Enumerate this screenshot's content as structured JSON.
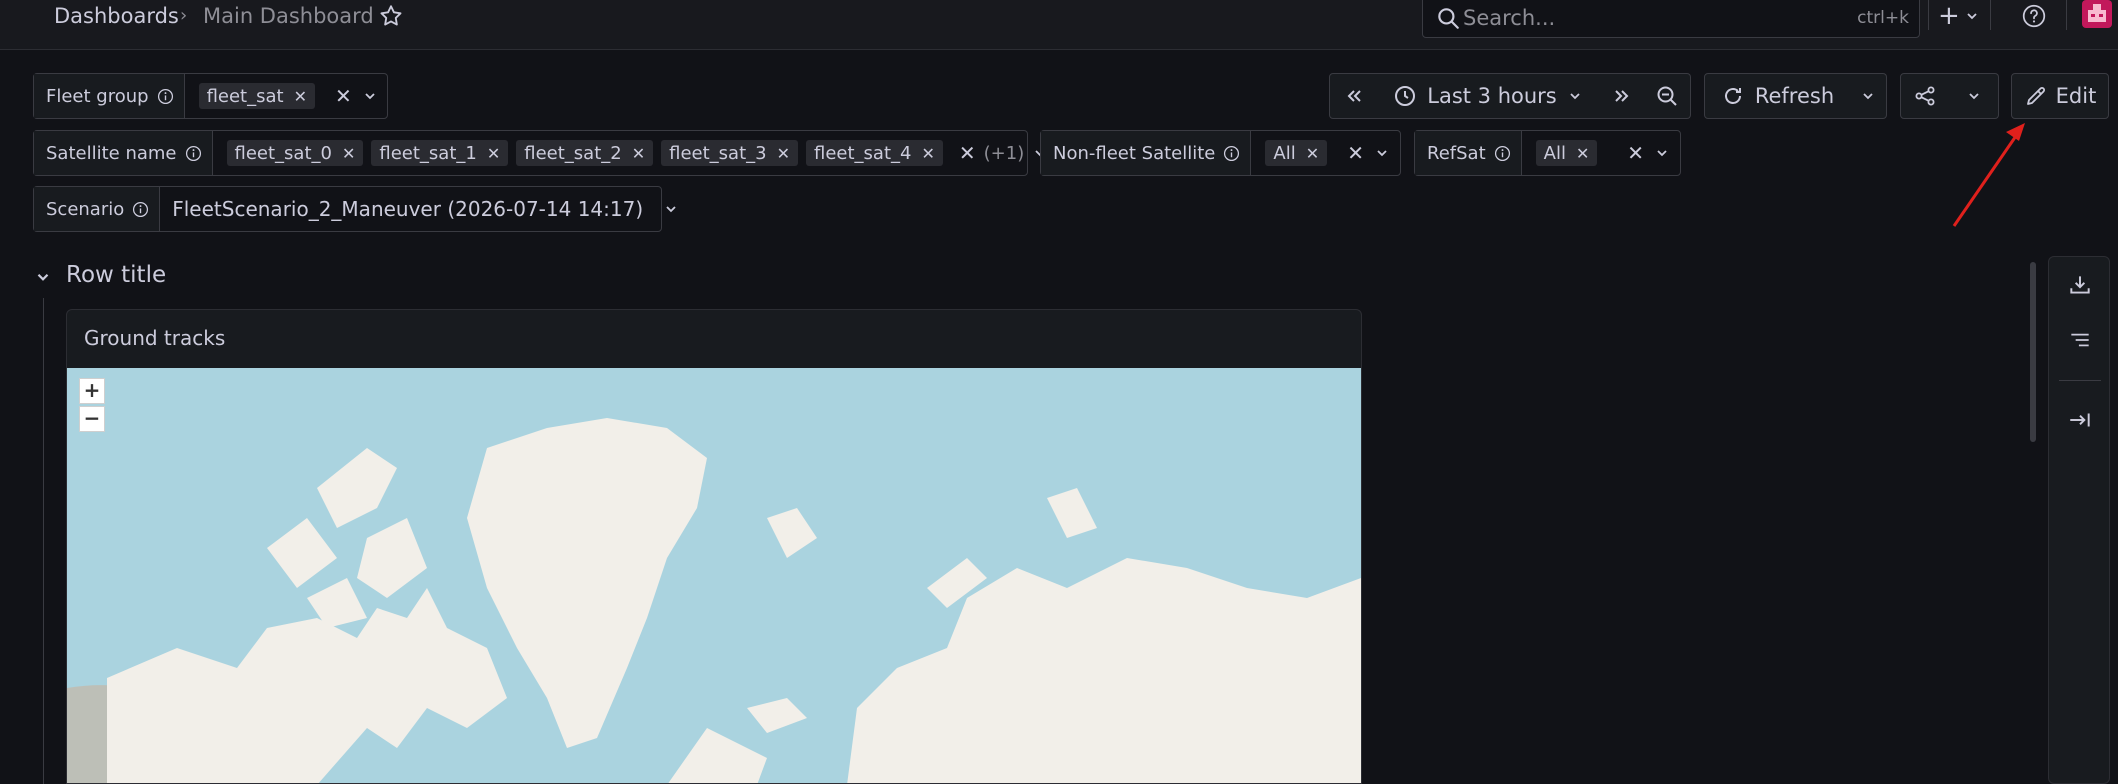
{
  "header": {
    "breadcrumb_root": "Dashboards",
    "breadcrumb_separator": "›",
    "breadcrumb_current": "Main Dashboard",
    "search_placeholder": "Search...",
    "search_shortcut": "ctrl+k",
    "add_label": "+"
  },
  "variables": {
    "fleet_group": {
      "label": "Fleet group",
      "chips": [
        "fleet_sat"
      ]
    },
    "satellite_name": {
      "label": "Satellite name",
      "chips": [
        "fleet_sat_0",
        "fleet_sat_1",
        "fleet_sat_2",
        "fleet_sat_3",
        "fleet_sat_4"
      ],
      "more": "(+1)"
    },
    "non_fleet": {
      "label": "Non-fleet Satellite",
      "chips": [
        "All"
      ]
    },
    "refsat": {
      "label": "RefSat",
      "chips": [
        "All"
      ]
    },
    "scenario": {
      "label": "Scenario",
      "value": "FleetScenario_2_Maneuver (2026-07-14 14:17)"
    }
  },
  "time": {
    "range_label": "Last 3 hours",
    "refresh_label": "Refresh",
    "edit_label": "Edit"
  },
  "row": {
    "title": "Row title"
  },
  "panel": {
    "title": "Ground tracks",
    "zoom_in": "+",
    "zoom_out": "−"
  },
  "colors": {
    "background": "#111217",
    "map_water": "#aad3df",
    "map_land": "#f2efe9",
    "arrow": "#e0201c",
    "avatar": "#c2185b"
  }
}
